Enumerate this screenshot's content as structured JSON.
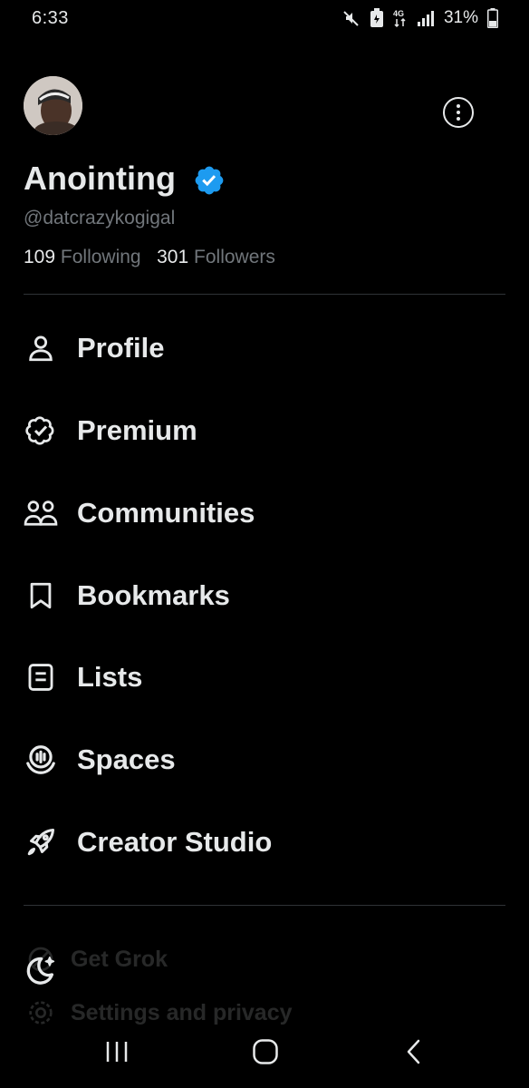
{
  "status_bar": {
    "time": "6:33",
    "battery": "31%"
  },
  "profile": {
    "name": "Anointing",
    "handle": "@datcrazykogigal",
    "following_count": "109",
    "following_label": "Following",
    "followers_count": "301",
    "followers_label": "Followers",
    "verified_color": "#1d9bf0"
  },
  "menu": {
    "items": [
      {
        "label": "Profile",
        "icon": "person-icon"
      },
      {
        "label": "Premium",
        "icon": "verified-outline-icon"
      },
      {
        "label": "Communities",
        "icon": "communities-icon"
      },
      {
        "label": "Bookmarks",
        "icon": "bookmark-icon"
      },
      {
        "label": "Lists",
        "icon": "list-icon"
      },
      {
        "label": "Spaces",
        "icon": "spaces-icon"
      },
      {
        "label": "Creator Studio",
        "icon": "rocket-icon"
      }
    ]
  },
  "secondary": {
    "grok_label": "Get Grok",
    "settings_label": "Settings and privacy"
  },
  "colors": {
    "background": "#000000",
    "text": "#e7e9ea",
    "muted": "#71767b",
    "accent": "#1d9bf0"
  }
}
